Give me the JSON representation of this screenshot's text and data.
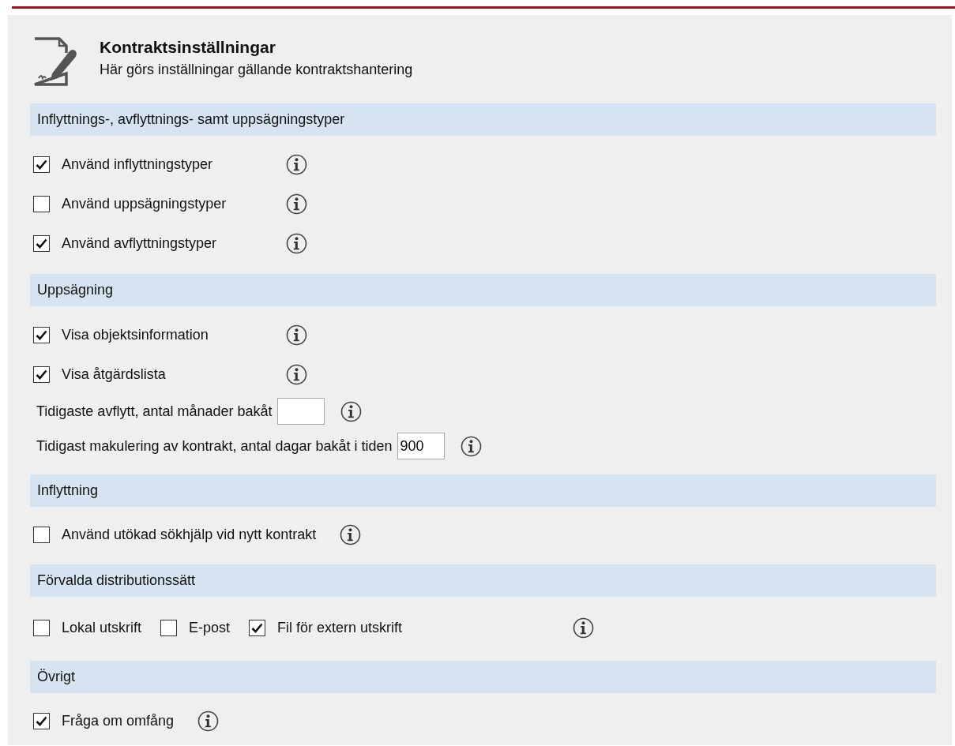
{
  "header": {
    "title": "Kontraktsinställningar",
    "subtitle": "Här görs inställningar gällande kontraktshantering"
  },
  "sections": [
    {
      "title": "Inflyttnings-, avflyttnings- samt uppsägningstyper",
      "rows": [
        {
          "kind": "checkbox",
          "label": "Använd inflyttningstyper",
          "checked": true
        },
        {
          "kind": "checkbox",
          "label": "Använd uppsägningstyper",
          "checked": false
        },
        {
          "kind": "checkbox",
          "label": "Använd avflyttningstyper",
          "checked": true
        }
      ]
    },
    {
      "title": "Uppsägning",
      "rows": [
        {
          "kind": "checkbox",
          "label": "Visa objektsinformation",
          "checked": true
        },
        {
          "kind": "checkbox",
          "label": "Visa åtgärdslista",
          "checked": true
        },
        {
          "kind": "field",
          "label": "Tidigaste avflytt, antal månader bakåt"
        },
        {
          "kind": "field",
          "label": "Tidigast makulering av kontrakt, antal dagar bakåt i tiden",
          "value": "900"
        }
      ]
    },
    {
      "title": "Inflyttning",
      "rows": [
        {
          "kind": "checkbox",
          "label": "Använd utökad sökhjälp vid nytt kontrakt",
          "checked": false
        }
      ]
    },
    {
      "title": "Förvalda distributionssätt",
      "rows": [
        {
          "kind": "group",
          "items": [
            {
              "label": "Lokal utskrift",
              "checked": false
            },
            {
              "label": "E-post",
              "checked": false
            },
            {
              "label": "Fil för extern utskrift",
              "checked": true
            }
          ]
        }
      ]
    },
    {
      "title": "Övrigt",
      "rows": [
        {
          "kind": "checkbox",
          "label": "Fråga om omfång",
          "checked": true
        }
      ]
    }
  ]
}
